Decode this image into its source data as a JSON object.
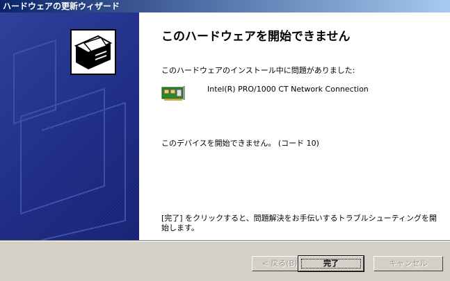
{
  "window": {
    "title": "ハードウェアの更新ウィザード"
  },
  "heading": "このハードウェアを開始できません",
  "problem_text": "このハードウェアのインストール中に問題がありました:",
  "device": {
    "name": "Intel(R) PRO/1000 CT Network Connection",
    "icon": "network-card-icon"
  },
  "status_text": "このデバイスを開始できません。 (コード 10)",
  "hint_text": "[完了] をクリックすると、問題解決をお手伝いするトラブルシューティングを開始します。",
  "buttons": {
    "back": "< 戻る(B)",
    "finish": "完了",
    "cancel": "キャンセル"
  },
  "colors": {
    "sidebar": "#1c2a82",
    "titlebar_start": "#0a246a",
    "titlebar_end": "#a6caf0",
    "dialog_bg": "#d4d0c8"
  }
}
